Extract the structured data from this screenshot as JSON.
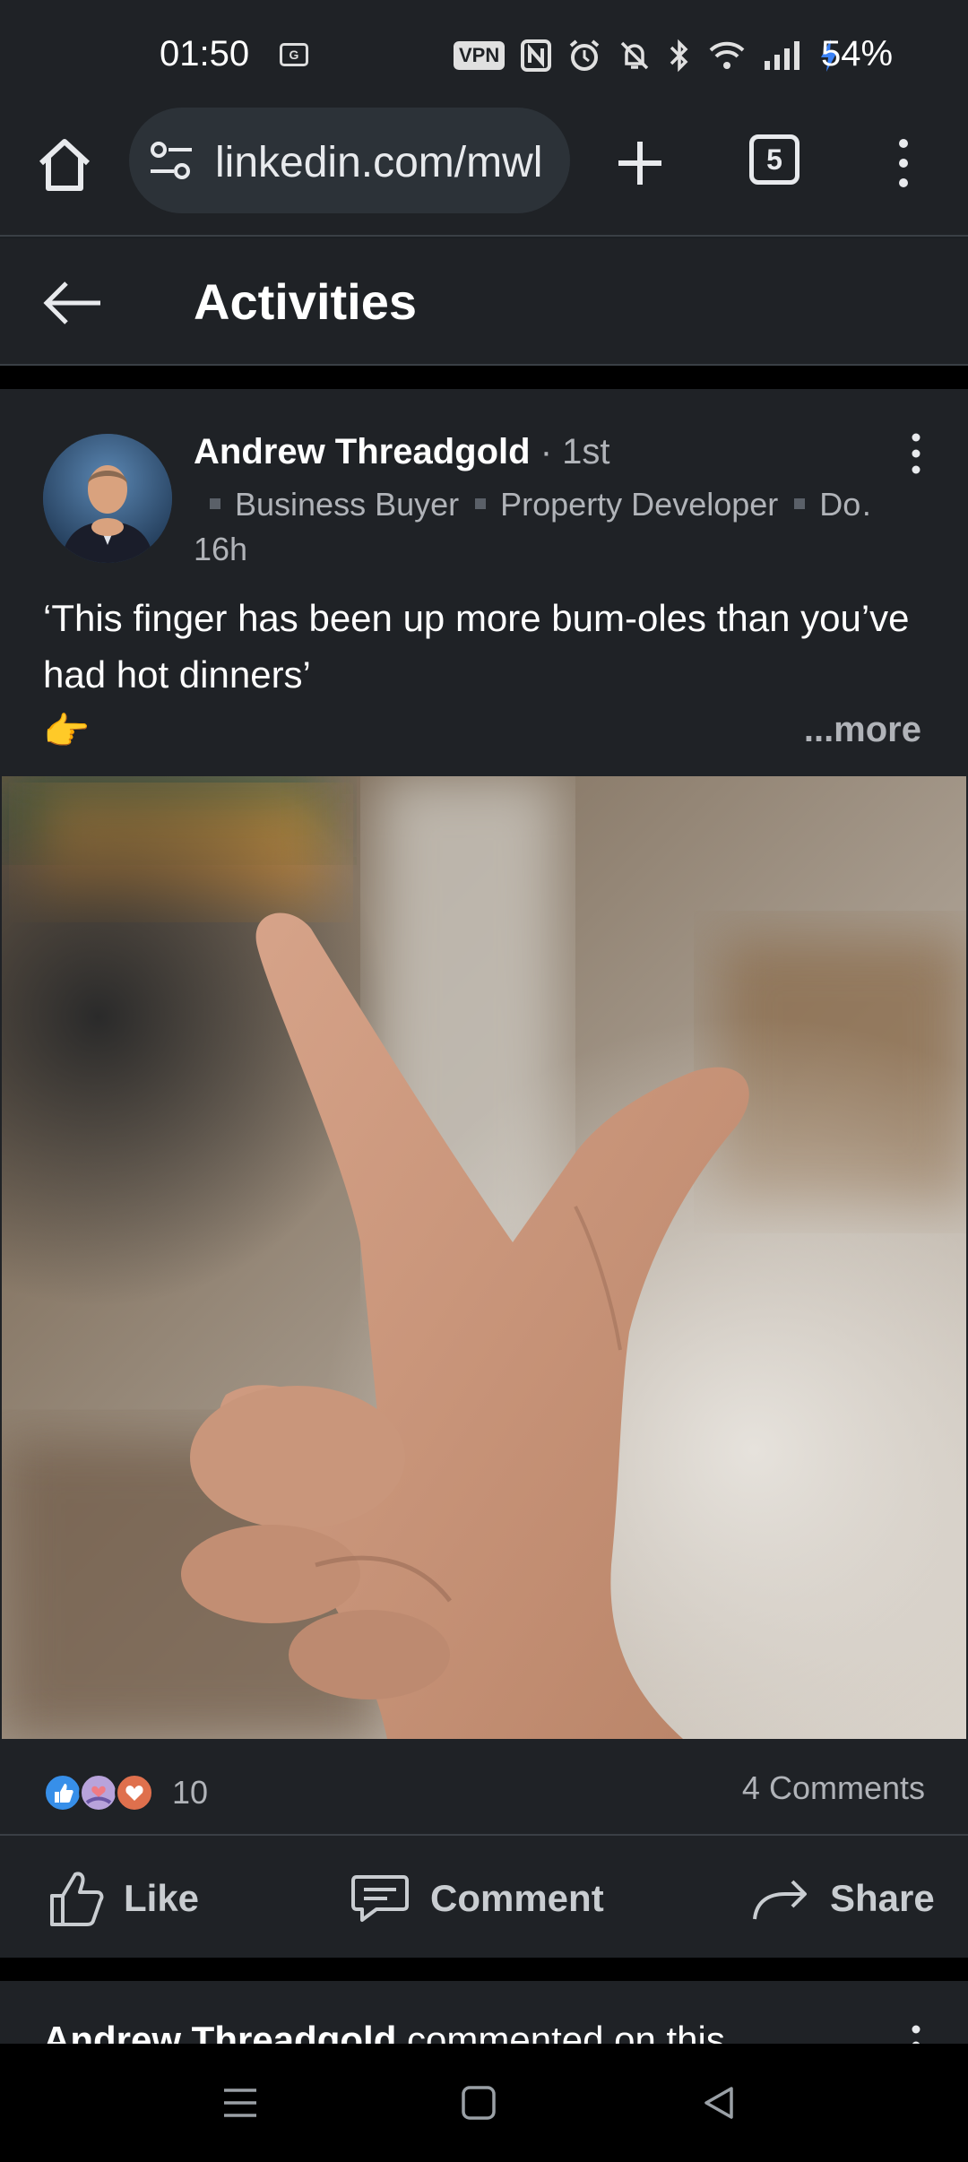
{
  "status_bar": {
    "time": "01:50",
    "vpn": "VPN",
    "battery": "54%"
  },
  "browser": {
    "url": "linkedin.com/mwl",
    "tab_count": "5"
  },
  "header": {
    "title": "Activities"
  },
  "post": {
    "author_name": "Andrew Threadgold",
    "connection_degree": "1st",
    "headline_items": [
      "Business Buyer",
      "Property Developer",
      "Do…"
    ],
    "time_ago": "16h",
    "text": "‘This finger has been up more bum-oles than you’ve had hot dinners’",
    "emoji": "👉",
    "more_label": "...more",
    "reaction_count": "10",
    "comments_label": "4 Comments",
    "actions": {
      "like": "Like",
      "comment": "Comment",
      "share": "Share"
    }
  },
  "next_activity": {
    "author": "Andrew Threadgold",
    "text": " commented on this"
  },
  "colors": {
    "background": "#1f2226",
    "text_primary": "#ffffff",
    "text_secondary": "#b0b3b8",
    "like_blue": "#378fe9",
    "love_red": "#df704d"
  }
}
